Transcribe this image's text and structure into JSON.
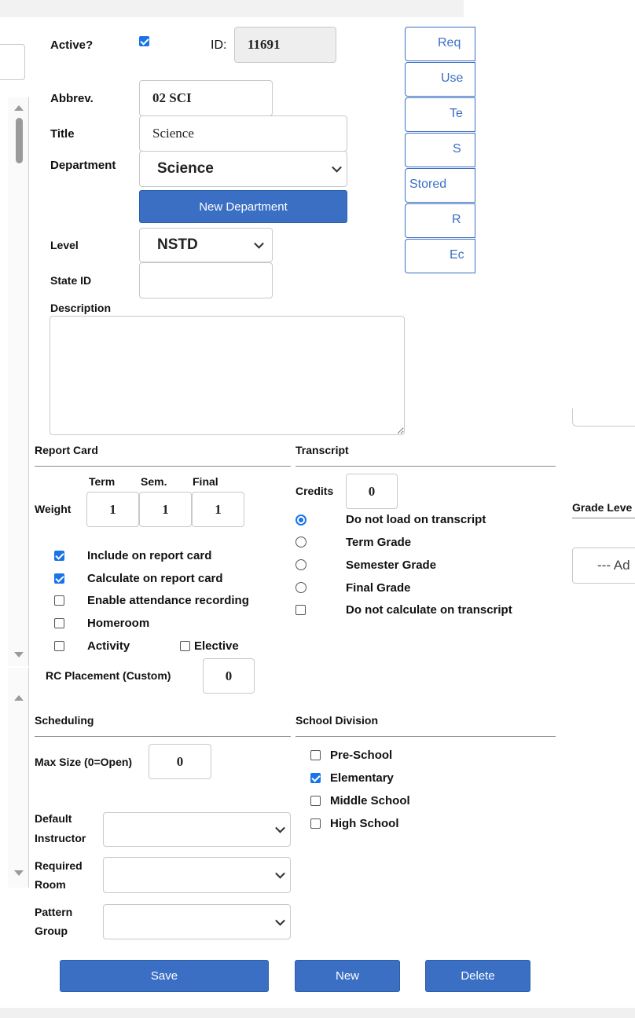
{
  "form": {
    "active_label": "Active?",
    "active_checked": true,
    "id_label": "ID:",
    "id_value": "11691",
    "abbrev_label": "Abbrev.",
    "abbrev_value": "02 SCI",
    "title_label": "Title",
    "title_value": "Science",
    "department_label": "Department",
    "department_value": "Science",
    "new_department_label": "New Department",
    "level_label": "Level",
    "level_value": "NSTD",
    "state_id_label": "State ID",
    "state_id_value": "",
    "description_label": "Description",
    "description_value": ""
  },
  "side_buttons": [
    "Req",
    "Use",
    "Te",
    "S",
    "Stored",
    "R",
    "Ec"
  ],
  "report_card": {
    "heading": "Report Card",
    "weight_label": "Weight",
    "col_term": "Term",
    "col_sem": "Sem.",
    "col_final": "Final",
    "weight_term": "1",
    "weight_sem": "1",
    "weight_final": "1",
    "options": [
      {
        "label": "Include on report card",
        "checked": true
      },
      {
        "label": "Calculate on report card",
        "checked": true
      },
      {
        "label": "Enable attendance recording",
        "checked": false
      },
      {
        "label": "Homeroom",
        "checked": false
      },
      {
        "label": "Activity",
        "checked": false
      }
    ],
    "elective_label": "Elective",
    "elective_checked": false,
    "placement_label": "RC Placement (Custom)",
    "placement_value": "0"
  },
  "transcript": {
    "heading": "Transcript",
    "credits_label": "Credits",
    "credits_value": "0",
    "radios": [
      {
        "label": "Do not load on transcript",
        "selected": true
      },
      {
        "label": "Term Grade",
        "selected": false
      },
      {
        "label": "Semester Grade",
        "selected": false
      },
      {
        "label": "Final Grade",
        "selected": false
      }
    ],
    "no_calc_label": "Do not calculate on transcript",
    "no_calc_checked": false
  },
  "grade_levels": {
    "heading": "Grade Leve",
    "add_placeholder": "--- Ad"
  },
  "scheduling": {
    "heading": "Scheduling",
    "max_size_label": "Max Size (0=Open)",
    "max_size_value": "0",
    "default_instructor_label_1": "Default",
    "default_instructor_label_2": "Instructor",
    "default_instructor_value": "",
    "required_room_label_1": "Required",
    "required_room_label_2": "Room",
    "required_room_value": "",
    "pattern_group_label_1": "Pattern",
    "pattern_group_label_2": "Group",
    "pattern_group_value": ""
  },
  "school_division": {
    "heading": "School Division",
    "options": [
      {
        "label": "Pre-School",
        "checked": false
      },
      {
        "label": "Elementary",
        "checked": true
      },
      {
        "label": "Middle School",
        "checked": false
      },
      {
        "label": "High School",
        "checked": false
      }
    ]
  },
  "actions": {
    "save": "Save",
    "new": "New",
    "delete": "Delete"
  },
  "colors": {
    "primary": "#3a6fc4",
    "checkbox": "#1a73e8"
  }
}
